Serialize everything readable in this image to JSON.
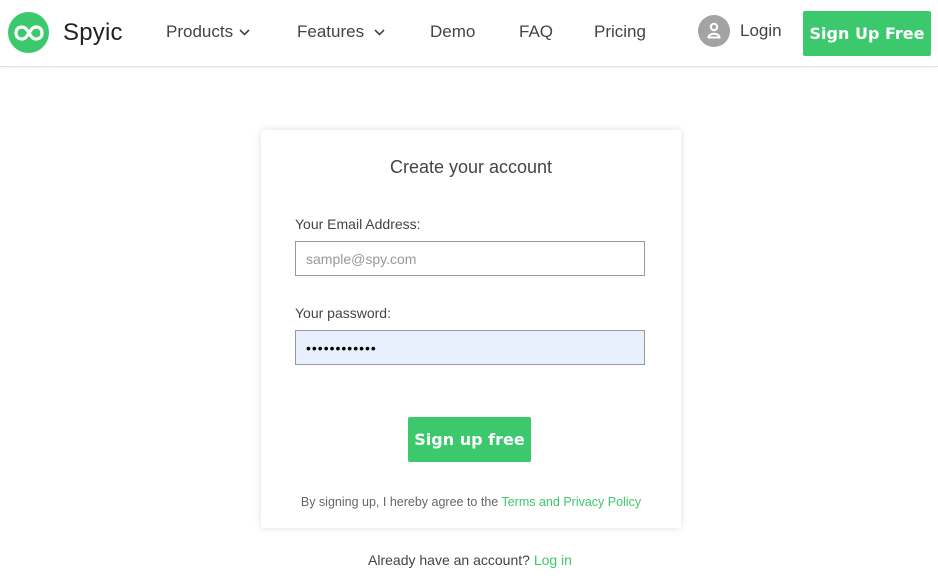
{
  "brand": {
    "name": "Spyic",
    "accent_color": "#3cc86c"
  },
  "nav": {
    "products": "Products",
    "features": "Features",
    "demo": "Demo",
    "faq": "FAQ",
    "pricing": "Pricing",
    "login": "Login",
    "signup": "Sign Up Free"
  },
  "form": {
    "title": "Create your account",
    "email_label": "Your Email Address:",
    "email_placeholder": "sample@spy.com",
    "email_value": "",
    "password_label": "Your password:",
    "password_value": "••••••••••••",
    "submit_label": "Sign up free",
    "terms_prefix": "By signing up, I hereby agree to the",
    "terms_link": "Terms and Privacy Policy"
  },
  "footer": {
    "already_text": "Already have an account?",
    "login_link": "Log in"
  },
  "icons": {
    "logo": "infinity-icon",
    "chevron": "chevron-down-icon",
    "user": "user-icon"
  }
}
